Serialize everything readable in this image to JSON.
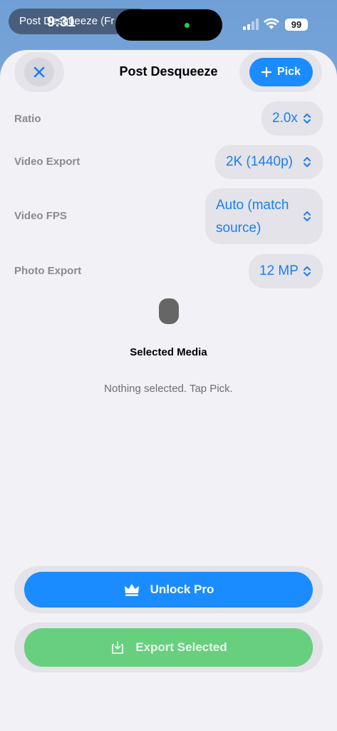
{
  "status": {
    "app_banner": "Post Desqueeze (Fr",
    "time": "9:31",
    "battery": "99"
  },
  "header": {
    "title": "Post Desqueeze",
    "pick_label": "Pick"
  },
  "settings": {
    "ratio": {
      "label": "Ratio",
      "value": "2.0x"
    },
    "video_export": {
      "label": "Video Export",
      "value": "2K (1440p)"
    },
    "video_fps": {
      "label": "Video FPS",
      "value_line1": "Auto (match",
      "value_line2": "source)"
    },
    "photo_export": {
      "label": "Photo Export",
      "value": "12 MP"
    }
  },
  "media": {
    "title": "Selected Media",
    "empty_text": "Nothing selected. Tap Pick."
  },
  "actions": {
    "unlock_label": "Unlock Pro",
    "export_label": "Export Selected"
  },
  "colors": {
    "accent": "#1a8cff",
    "export_green": "#68cf7f"
  }
}
